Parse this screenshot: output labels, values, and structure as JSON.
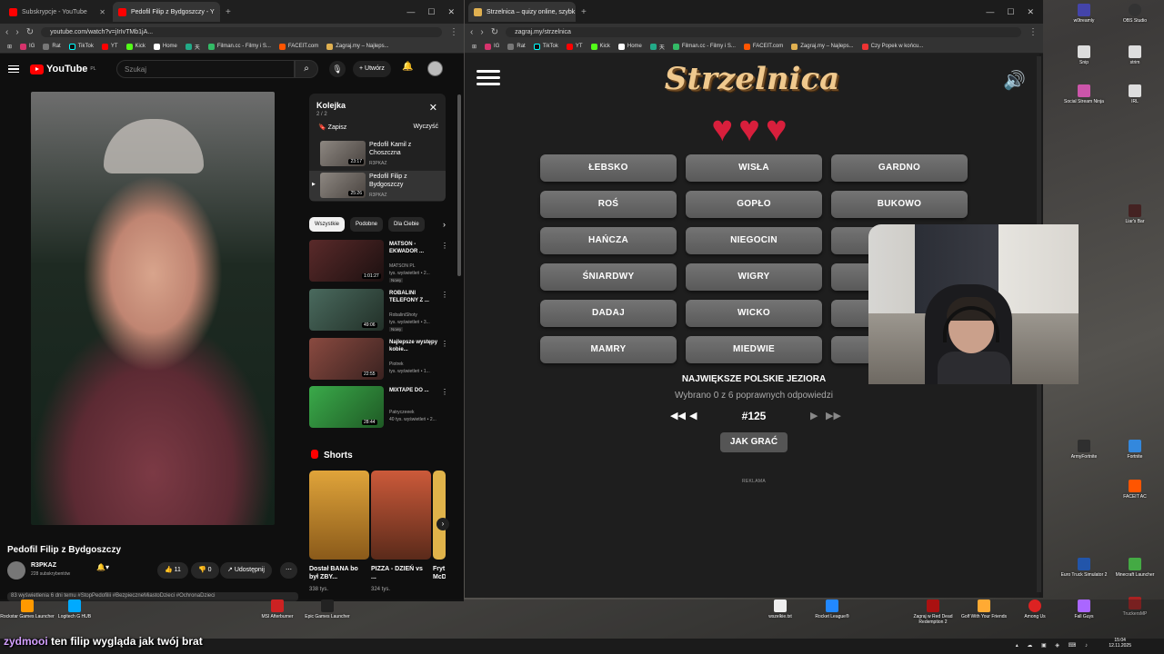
{
  "left_browser": {
    "tabs": [
      {
        "title": "Subskrypcje - YouTube",
        "color": "#ff0000"
      },
      {
        "title": "Pedofil Filip z Bydgoszczy - Y",
        "color": "#ff0000"
      }
    ],
    "url": "youtube.com/watch?v=jIrIvTMb1jA...",
    "bookmarks": [
      "IG",
      "Rat",
      "TikTok",
      "YT",
      "Kick",
      "Home",
      "天",
      "Filman.cc - Filmy i S...",
      "FACEIT.com",
      "Zagraj.my – Najleps..."
    ]
  },
  "youtube": {
    "logo": "YouTube",
    "logo_sup": "PL",
    "search_placeholder": "Szukaj",
    "create_label": "Utwórz",
    "video_title": "Pedofil Filip z Bydgoszczy",
    "channel": {
      "name": "R3PKAZ",
      "subs": "228 subskrybentów"
    },
    "likes": "11",
    "dislikes": "0",
    "share_label": "Udostępnij",
    "description": "83 wyświetlenia  6 dni temu  #StopPedofilii #BezpieczneMiastoDzieci #OchronaDzieci",
    "queue": {
      "title": "Kolejka",
      "count": "2 / 2",
      "save": "Zapisz",
      "clear": "Wyczyść",
      "items": [
        {
          "title": "Pedofil Kamil z Choszczna",
          "channel": "R3PKAZ",
          "duration": "23:17"
        },
        {
          "title": "Pedofil Filip z Bydgoszczy",
          "channel": "R3PKAZ",
          "duration": "25:26"
        }
      ]
    },
    "chips": [
      "Wszystkie",
      "Podobne",
      "Dla Ciebie"
    ],
    "recommendations": [
      {
        "title": "MATSON - EKWADOR ...",
        "channel": "MATSON PL",
        "views": "tys. wyświetleń • 2...",
        "duration": "1:01:27",
        "badge": "Nowy",
        "thumb": "#3a1f1f"
      },
      {
        "title": "ROBALINI TELEFONY Z ...",
        "channel": "RobaliniShoty",
        "views": "tys. wyświetleń • 3...",
        "duration": "49:06",
        "badge": "Nowy",
        "thumb": "#3f5a4f"
      },
      {
        "title": "Najlepsze występy kobie...",
        "channel": "Piotrek",
        "views": "tys. wyświetleń • 1...",
        "duration": "22:55",
        "badge": "",
        "thumb": "#6a3a35"
      },
      {
        "title": "MIXTAPE DO ...",
        "channel": "Patryczeeek",
        "views": "40 tys. wyświetleń • 2...",
        "duration": "28:44",
        "badge": "",
        "thumb": "#2a8a3a"
      }
    ],
    "shorts_title": "Shorts",
    "shorts": [
      {
        "title": "Dostał BANA bo był ZBY...",
        "views": "338 tys.",
        "thumb": "#d99a2a"
      },
      {
        "title": "PIZZA - DZIEŃ vs ...",
        "views": "324 tys.",
        "thumb": "#c8452f"
      },
      {
        "title": "Fryt McD",
        "views": "",
        "thumb": "#e0b34a"
      }
    ]
  },
  "right_browser": {
    "tab_title": "Strzelnica – quizy online, szybk",
    "url": "zagraj.my/strzelnica",
    "bookmarks": [
      "IG",
      "Rat",
      "TikTok",
      "YT",
      "Kick",
      "Home",
      "天",
      "Filman.cc - Filmy i S...",
      "FACEIT.com",
      "Zagraj.my – Najleps...",
      "Czy Popek w końcu..."
    ]
  },
  "game": {
    "logo": "Strzelnica",
    "hearts": "♥♥♥",
    "lives": 3,
    "options": [
      "ŁEBSKO",
      "WISŁA",
      "GARDNO",
      "ROŚ",
      "GOPŁO",
      "BUKOWO",
      "HAŃCZA",
      "NIEGOCIN",
      "",
      "ŚNIARDWY",
      "WIGRY",
      "",
      "DADAJ",
      "WICKO",
      "",
      "MAMRY",
      "MIEDWIE",
      ""
    ],
    "question": "NAJWIĘKSZE POLSKIE JEZIORA",
    "progress": "Wybrano 0 z 6 poprawnych odpowiedzi",
    "number": "#125",
    "how_to": "JAK GRAĆ",
    "ad": "REKLAMA"
  },
  "desktop_icons": [
    {
      "label": "w0treamly",
      "color": "#4444aa"
    },
    {
      "label": "OBS Studio",
      "color": "#333"
    },
    {
      "label": "Snip",
      "color": "#ddd"
    },
    {
      "label": "strim",
      "color": "#ddd"
    },
    {
      "label": "Social Stream Ninja",
      "color": "#cc55aa"
    },
    {
      "label": "IRL",
      "color": "#ddd"
    },
    {
      "label": "Liar's Bar",
      "color": "#442222"
    },
    {
      "label": "ArmyFortnite",
      "color": "#2f2f2f"
    },
    {
      "label": "Fortnite",
      "color": "#3388dd"
    },
    {
      "label": "FACEIT AC",
      "color": "#ff5500"
    },
    {
      "label": "Euro Truck Simulator 2",
      "color": "#2255aa"
    },
    {
      "label": "Minecraft Launcher",
      "color": "#44aa44"
    },
    {
      "label": "TruckersMP",
      "color": "#aa2222"
    }
  ],
  "taskbar": {
    "icons": [
      "Rockstar Games Launcher",
      "Logitech G HUB",
      "MSI Afterburner",
      "Epic Games Launcher",
      "wszelkie.txt",
      "Rocket League®",
      "Zagraj w Red Dead Redemption 2",
      "Golf With Your Friends",
      "Among Us",
      "Fall Guys"
    ],
    "time": "15:04",
    "date": "12.11.2025"
  },
  "chat": {
    "user": "zydmooi",
    "message": "ten filip wygląda jak twój brat"
  }
}
